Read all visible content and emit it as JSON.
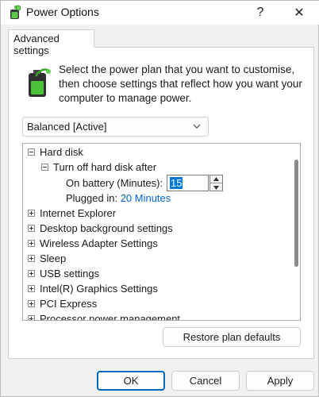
{
  "window": {
    "title": "Power Options",
    "help_glyph": "?",
    "close_glyph": "✕"
  },
  "tabs": [
    {
      "label": "Advanced settings"
    }
  ],
  "intro_text": "Select the power plan that you want to customise, then choose settings that reflect how you want your computer to manage power.",
  "plan_select": {
    "value": "Balanced [Active]"
  },
  "tree": {
    "hard_disk": "Hard disk",
    "turn_off": "Turn off hard disk after",
    "on_battery_label": "On battery (Minutes):",
    "on_battery_value": "15",
    "plugged_in_label": "Plugged in:",
    "plugged_in_value": "20 Minutes",
    "items": [
      "Internet Explorer",
      "Desktop background settings",
      "Wireless Adapter Settings",
      "Sleep",
      "USB settings",
      "Intel(R) Graphics Settings",
      "PCI Express",
      "Processor power management"
    ]
  },
  "buttons": {
    "restore": "Restore plan defaults",
    "ok": "OK",
    "cancel": "Cancel",
    "apply": "Apply"
  },
  "colors": {
    "accent": "#0078d7",
    "link": "#0066cc"
  }
}
